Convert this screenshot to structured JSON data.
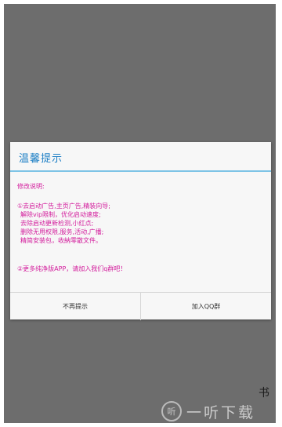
{
  "dialog": {
    "title": "温馨提示",
    "intro": "修改说明:",
    "items": [
      "①去启动广告,主页广告,精装向导;",
      "解除vip限制，优化启动速度;",
      "去除启动更新检测,小红点;",
      "删除无用权限,服务,活动,广播;",
      "精简安装包，收納零散文件。"
    ],
    "footer": "②更多纯净版APP，请加入我们q群吧！",
    "buttons": {
      "left": "不再提示",
      "right": "加入QQ群"
    }
  },
  "corner_glyph": "书",
  "watermark": {
    "logo": "听",
    "text": "一听下载"
  },
  "colors": {
    "title": "#1f80c6",
    "message": "#d31c9c",
    "overlay": "#6d6d6d"
  }
}
